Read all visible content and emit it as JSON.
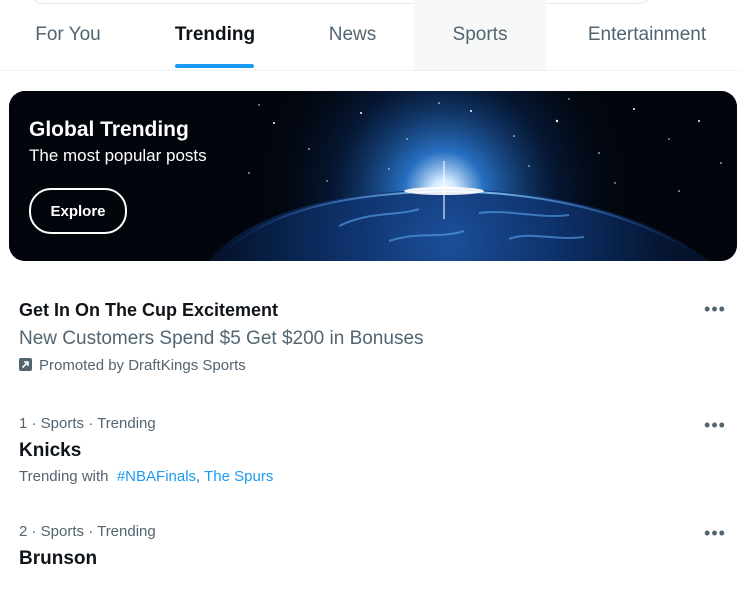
{
  "tabs": [
    {
      "label": "For You"
    },
    {
      "label": "Trending"
    },
    {
      "label": "News"
    },
    {
      "label": "Sports"
    },
    {
      "label": "Entertainment"
    }
  ],
  "active_tab": "Trending",
  "banner": {
    "title": "Global Trending",
    "subtitle": "The most popular posts",
    "button_label": "Explore"
  },
  "promoted": {
    "title": "Get In On The Cup Excitement",
    "subtitle": "New Customers Spend $5 Get $200 in Bonuses",
    "promoted_by": "Promoted by DraftKings Sports",
    "more_icon": "ellipsis-icon"
  },
  "trends": [
    {
      "meta": "1 · Sports · Trending",
      "name": "Knicks",
      "trending_with_label": "Trending with",
      "tags": [
        "#NBAFinals",
        "The Spurs"
      ],
      "separator": ","
    },
    {
      "meta": "2 · Sports · Trending",
      "name": "Brunson"
    }
  ],
  "colors": {
    "accent": "#1d9bf0",
    "secondary_text": "#536471",
    "primary_text": "#0f1419"
  }
}
